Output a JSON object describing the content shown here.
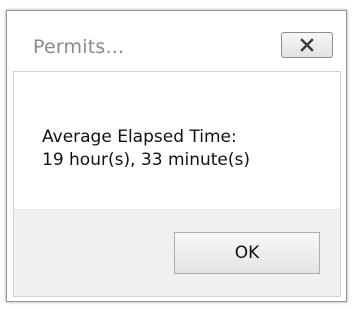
{
  "window": {
    "title": "Permits...",
    "close_icon": "close-x-icon"
  },
  "message": {
    "line1": "Average Elapsed Time:",
    "line2": "19 hour(s), 33 minute(s)"
  },
  "buttons": {
    "ok_label": "OK"
  }
}
